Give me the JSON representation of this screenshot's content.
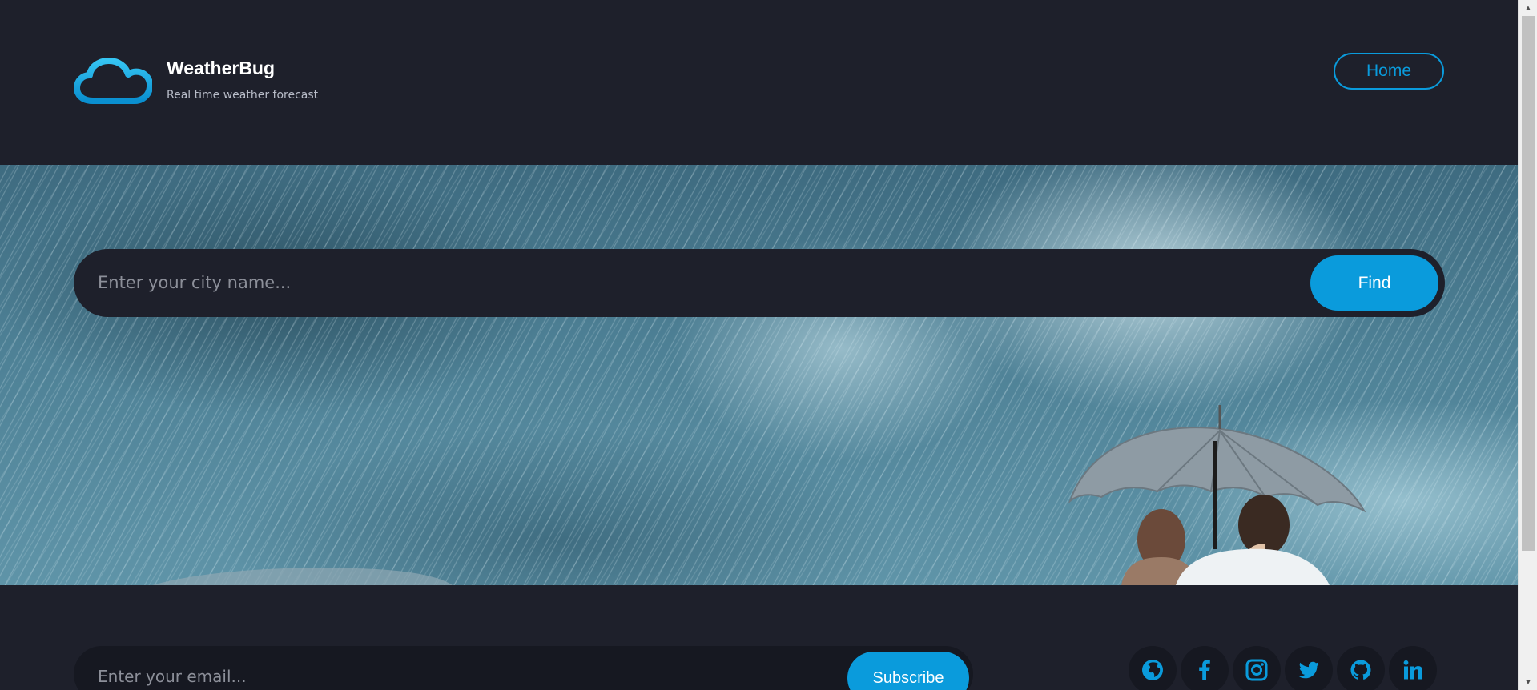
{
  "header": {
    "brand_title": "WeatherBug",
    "brand_subtitle": "Real time weather forecast",
    "logo_icon": "cloud-icon",
    "nav_home_label": "Home"
  },
  "hero": {
    "search_placeholder": "Enter your city name...",
    "search_value": "",
    "find_label": "Find",
    "background": "rain-umbrella-photo"
  },
  "footer": {
    "email_placeholder": "Enter your email...",
    "email_value": "",
    "subscribe_label": "Subscribe",
    "social_icons": [
      "globe-icon",
      "facebook-icon",
      "instagram-icon",
      "twitter-icon",
      "github-icon",
      "linkedin-icon"
    ]
  },
  "colors": {
    "background": "#1e202b",
    "accent": "#0a9bdc",
    "text": "#ffffff",
    "muted_text": "#b8bcc8"
  }
}
